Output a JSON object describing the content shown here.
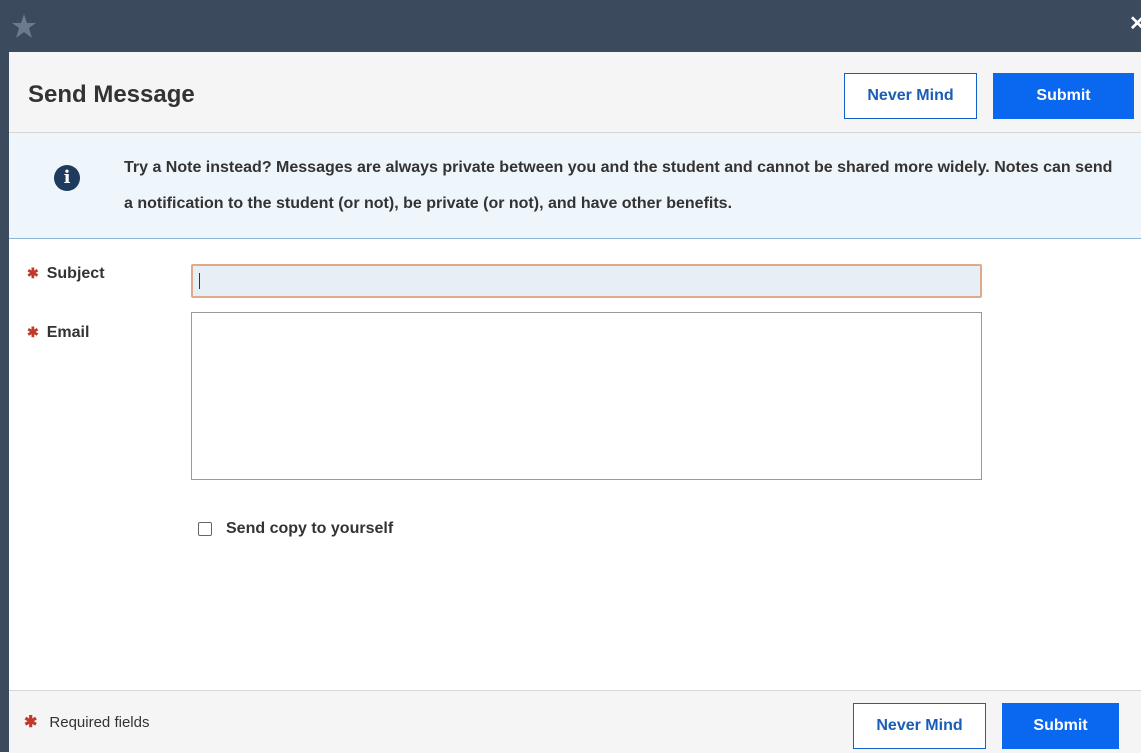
{
  "dialog": {
    "title": "Send Message",
    "never_mind_label": "Never Mind",
    "submit_label": "Submit"
  },
  "notice": {
    "icon": "info-icon",
    "text": "Try a Note instead? Messages are always private between you and the student and cannot be shared more widely. Notes can send a notification to the student (or not), be private (or not), and have other benefits."
  },
  "form": {
    "subject_label": "Subject",
    "subject_value": "",
    "email_label": "Email",
    "email_value": "",
    "required_marker": "✱",
    "send_copy_label": "Send copy to yourself",
    "send_copy_checked": false
  },
  "footer": {
    "required_label": "Required fields",
    "never_mind_label": "Never Mind",
    "submit_label": "Submit"
  },
  "colors": {
    "topbar": "#3c4a5e",
    "primary": "#0a67f0",
    "required": "#c0392b",
    "notice_bg": "#eef5fb"
  }
}
